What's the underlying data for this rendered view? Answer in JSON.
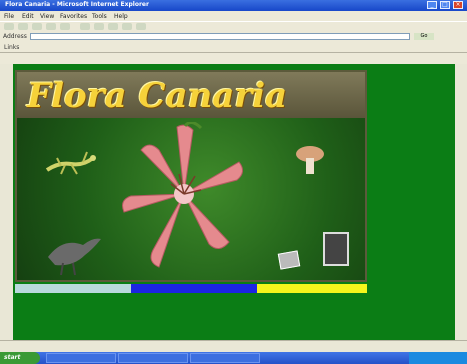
{
  "window": {
    "title": "Flora Canaria - Microsoft Internet Explorer"
  },
  "menu": [
    "File",
    "Edit",
    "View",
    "Favorites",
    "Tools",
    "Help"
  ],
  "address": {
    "label": "Address",
    "value": "",
    "go_label": "Go"
  },
  "links": {
    "label": "Links"
  },
  "site": {
    "title": "Flora Canaria",
    "links": {
      "top_left": "",
      "top_right": "",
      "center": "",
      "left_bottom": "",
      "right_bottom": "",
      "bottom_mid": ""
    }
  },
  "navbar": {
    "seg1": "",
    "seg2": "",
    "seg4": ""
  },
  "taskbar": {
    "start_label": "start",
    "tray_time": ""
  },
  "colors": {
    "page_background": "#0a7a12",
    "title_gold": "#f6d23a",
    "nav_blue": "#1c25e4",
    "nav_yellow": "#f5f51c"
  }
}
